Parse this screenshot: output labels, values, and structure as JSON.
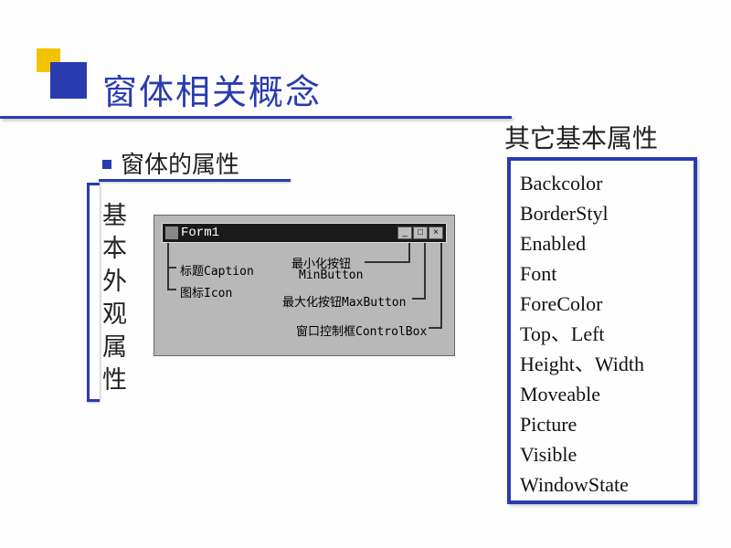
{
  "title": "窗体相关概念",
  "subtitle": "窗体的属性",
  "vertical_label": "基本外观属性",
  "form_title": "Form1",
  "diagram_labels": {
    "caption_label": "标题Caption",
    "icon_label": "图标Icon",
    "min_cn": "最小化按钮",
    "min_en": "MinButton",
    "max_label": "最大化按钮MaxButton",
    "control_label": "窗口控制框ControlBox"
  },
  "right_title": "其它基本属性",
  "basic_props": [
    "Backcolor",
    "BorderStyl",
    "Enabled",
    "Font",
    "ForeColor",
    "Top、Left",
    "Height、Width",
    "Moveable",
    "Picture",
    "Visible",
    "WindowState"
  ]
}
